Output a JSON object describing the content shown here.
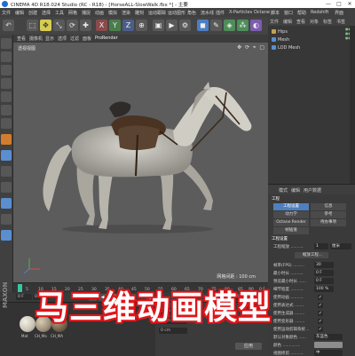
{
  "window": {
    "title": "CINEMA 4D R18.024 Studio (RC - R18) - [HorseALL-SlowWalk.fbx *] - 主要",
    "controls": [
      "—",
      "□",
      "✕"
    ]
  },
  "menu": [
    "文件",
    "编辑",
    "创建",
    "选择",
    "工具",
    "网格",
    "捕捉",
    "动画",
    "模拟",
    "渲染",
    "雕刻",
    "运动跟踪",
    "运动图形",
    "角色",
    "流水线",
    "插件",
    "X-Particles",
    "Octane",
    "脚本",
    "窗口",
    "帮助",
    "Redshift",
    "界面"
  ],
  "toolbar": {
    "buttons": [
      "undo-icon",
      "select-icon",
      "move-icon",
      "scale-icon",
      "rotate-icon",
      "last-tool-icon",
      "x-axis-icon",
      "y-axis-icon",
      "z-axis-icon",
      "coord-icon",
      "render-region-icon",
      "render-view-icon",
      "render-settings-icon",
      "cube-icon",
      "pen-icon",
      "subdivide-icon",
      "array-icon",
      "deformer-icon",
      "floor-icon",
      "camera-icon",
      "light-icon"
    ]
  },
  "viewport": {
    "menu": [
      "查看",
      "摄像机",
      "显示",
      "选项",
      "过滤",
      "面板",
      "ProRender"
    ],
    "label": "透视视图",
    "grid_label": "网格间距 : 100 cm",
    "icons": "✥ ⟳ ⌖ ▢"
  },
  "timeline": {
    "ticks": [
      "0",
      "5",
      "10",
      "15",
      "20",
      "25",
      "30",
      "35",
      "40",
      "45",
      "50",
      "55",
      "60",
      "65",
      "70",
      "75",
      "80",
      "85",
      "90"
    ],
    "end_label": "0 F",
    "current": "0 F",
    "start": "0 F",
    "end": "90 F"
  },
  "materials": {
    "items": [
      {
        "label": "Mat",
        "color": "#c9c3b4"
      },
      {
        "label": "CH_Ma",
        "color": "#9c8f7a"
      },
      {
        "label": "CH_MA",
        "color": "#6f5f4a"
      }
    ],
    "brand": "MAXON"
  },
  "coords": {
    "apply_label": "应用",
    "fields": [
      "0 cm",
      "0 cm",
      "0 cm"
    ]
  },
  "objects": {
    "tabs": [
      "文件",
      "编辑",
      "查看",
      "对象",
      "标签",
      "书签"
    ],
    "rows": [
      {
        "label": "Hips",
        "color": "#c9a04a"
      },
      {
        "label": "Mesh",
        "color": "#5a8ed1"
      },
      {
        "label": "LOD Mesh",
        "color": "#5a8ed1"
      }
    ]
  },
  "attributes": {
    "header": [
      "模式",
      "编辑",
      "用户数据"
    ],
    "object_title": "工程",
    "tabs": [
      "工程设置",
      "信息",
      "动力学",
      "参考",
      "Octane Render",
      "待办事项",
      "帧插值"
    ],
    "section": "工程设置",
    "rows": [
      {
        "label": "工程缩放 ..........",
        "value": "1",
        "unit": "厘米"
      },
      {
        "label": "",
        "value": "缩放工程..."
      },
      {
        "label": "帧率(FPS) .........",
        "value": "30"
      },
      {
        "label": "最小时长 ..........",
        "value": "0 F"
      },
      {
        "label": "预览最小时长 ......",
        "value": "0 F"
      },
      {
        "label": "细节程度 ..........",
        "value": "100 %"
      },
      {
        "label": "使用动画 ..........",
        "check": "✓"
      },
      {
        "label": "使用表达式 ........",
        "check": "✓"
      },
      {
        "label": "使用生成器 ........",
        "check": "✓"
      },
      {
        "label": "使用变形器 ........",
        "check": "✓"
      },
      {
        "label": "使用运动剪辑系统 ..",
        "check": "✓"
      },
      {
        "label": "默认对象颜色 ......",
        "value": "灰蓝色"
      },
      {
        "label": "颜色 ..............",
        "value": ""
      },
      {
        "label": "视图修剪 ..........",
        "value": "中"
      }
    ]
  },
  "overlay": {
    "title": "马三维动画模型"
  }
}
